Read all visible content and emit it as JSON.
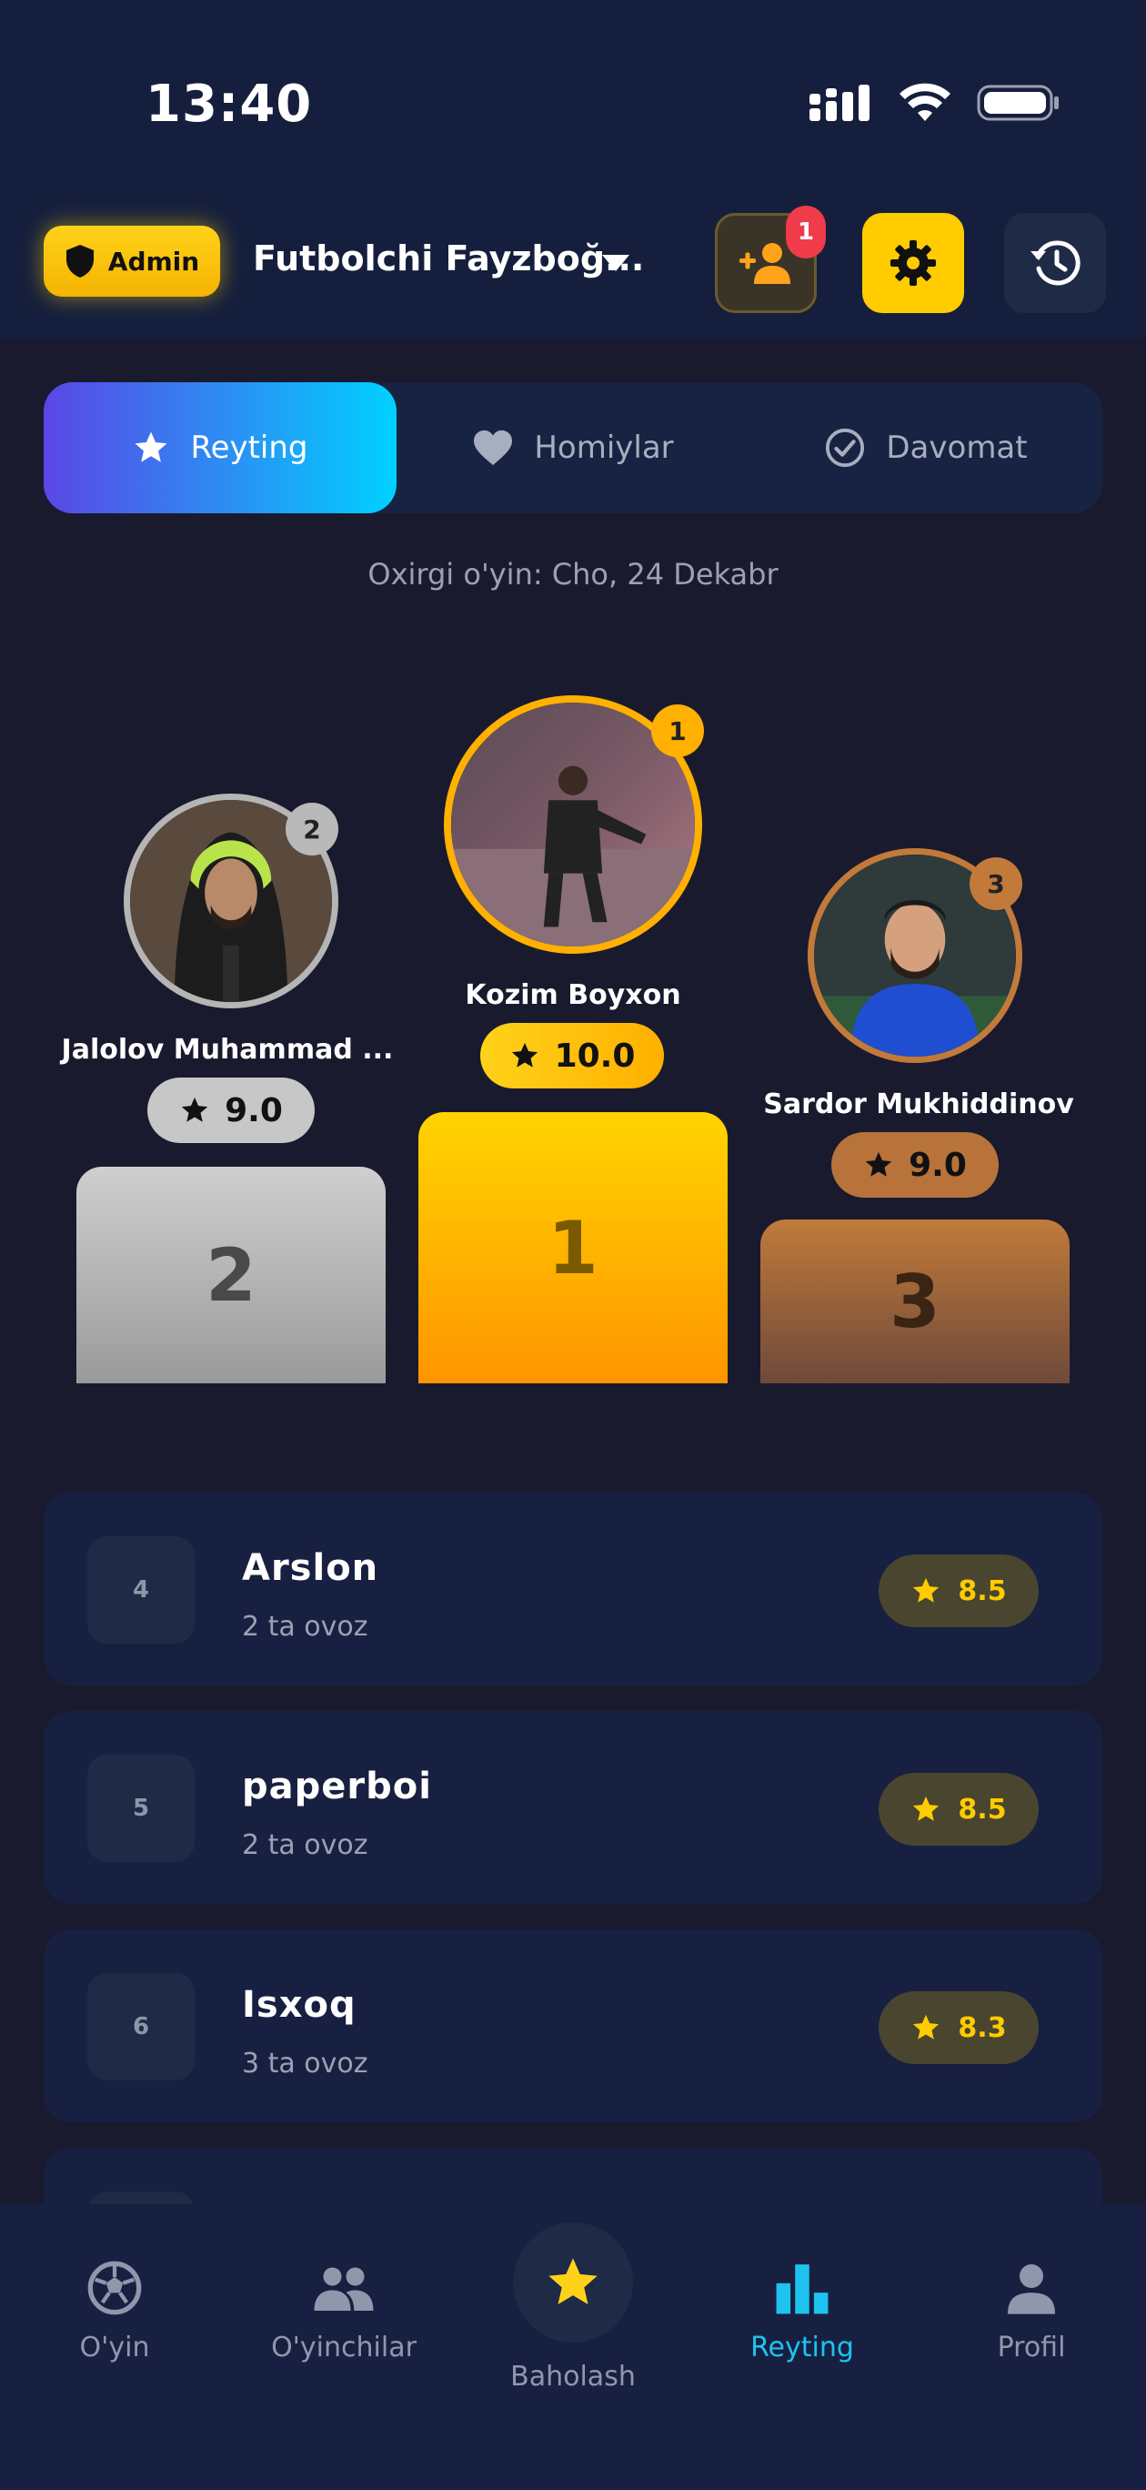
{
  "status_bar": {
    "time": "13:40"
  },
  "header": {
    "role_badge": "Admin",
    "team_name": "Futbolchi Fayzboğ...",
    "invite_notification_count": "1",
    "colors": {
      "accent": "#ffcc00",
      "badge": "#ef3b4a"
    }
  },
  "tabs": [
    {
      "label": "Reyting",
      "icon": "star-icon",
      "active": true
    },
    {
      "label": "Homiylar",
      "icon": "heart-icon",
      "active": false
    },
    {
      "label": "Davomat",
      "icon": "check-circle-icon",
      "active": false
    }
  ],
  "last_game": "Oxirgi o'yin: Cho, 24 Dekabr",
  "podium": [
    {
      "rank": "1",
      "name": "Kozim Boyxon",
      "score": "10.0",
      "pedestal": "1"
    },
    {
      "rank": "2",
      "name": "Jalolov Muhammad ...",
      "score": "9.0",
      "pedestal": "2"
    },
    {
      "rank": "3",
      "name": "Sardor Mukhiddinov",
      "score": "9.0",
      "pedestal": "3"
    }
  ],
  "leaderboard": [
    {
      "rank": "4",
      "name": "Arslon",
      "votes": "2 ta ovoz",
      "score": "8.5"
    },
    {
      "rank": "5",
      "name": "paperboi",
      "votes": "2 ta ovoz",
      "score": "8.5"
    },
    {
      "rank": "6",
      "name": "Isxoq",
      "votes": "3 ta ovoz",
      "score": "8.3"
    }
  ],
  "bottom_nav": [
    {
      "label": "O'yin",
      "icon": "soccer-ball-icon",
      "active": false
    },
    {
      "label": "O'yinchilar",
      "icon": "players-icon",
      "active": false
    },
    {
      "label": "Baholash",
      "icon": "star-icon",
      "active": false
    },
    {
      "label": "Reyting",
      "icon": "bar-chart-icon",
      "active": true
    },
    {
      "label": "Profil",
      "icon": "user-icon",
      "active": false
    }
  ]
}
